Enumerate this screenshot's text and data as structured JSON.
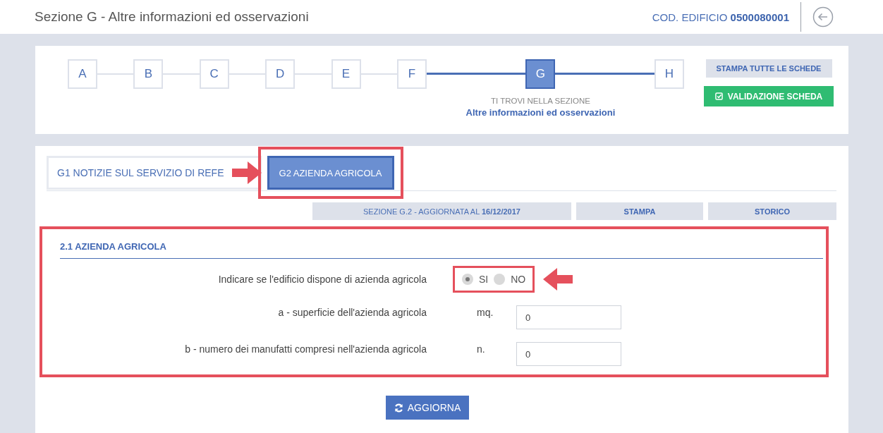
{
  "header": {
    "title": "Sezione G - Altre informazioni ed osservazioni",
    "code_label": "COD. EDIFICIO",
    "code_value": "0500080001"
  },
  "stepper": {
    "steps": [
      {
        "label": "A",
        "selected": false
      },
      {
        "label": "B",
        "selected": false
      },
      {
        "label": "C",
        "selected": false
      },
      {
        "label": "D",
        "selected": false
      },
      {
        "label": "E",
        "selected": false
      },
      {
        "label": "F",
        "selected": false
      },
      {
        "label": "G",
        "selected": true
      },
      {
        "label": "H",
        "selected": false
      }
    ],
    "caption": "TI TROVI NELLA SEZIONE",
    "current_section": "Altre informazioni ed osservazioni"
  },
  "actions": {
    "print_all": "STAMPA TUTTE LE SCHEDE",
    "validate": "VALIDAZIONE SCHEDA"
  },
  "tabs": [
    {
      "label": "G1 NOTIZIE SUL SERVIZIO DI REFE",
      "selected": false,
      "highlighted": false
    },
    {
      "label": "G2 AZIENDA AGRICOLA",
      "selected": true,
      "highlighted": true
    }
  ],
  "info_bar": {
    "updated": "SEZIONE G.2 - AGGIORNATA AL **16/12/2017**",
    "print": "STAMPA",
    "history": "STORICO"
  },
  "section": {
    "title": "2.1 AZIENDA AGRICOLA",
    "highlighted": true,
    "question": {
      "label": "Indicare se l'edificio dispone di azienda agricola",
      "highlighted": true,
      "options": [
        {
          "label": "SI",
          "selected": true
        },
        {
          "label": "NO",
          "selected": false
        }
      ]
    },
    "fields": [
      {
        "label": "a - superficie dell'azienda agricola",
        "unit": "mq.",
        "value": "0"
      },
      {
        "label": "b - numero dei manufatti compresi nell'azienda agricola",
        "unit": "n.",
        "value": "0"
      }
    ]
  },
  "update_button": "AGGIORNA"
}
